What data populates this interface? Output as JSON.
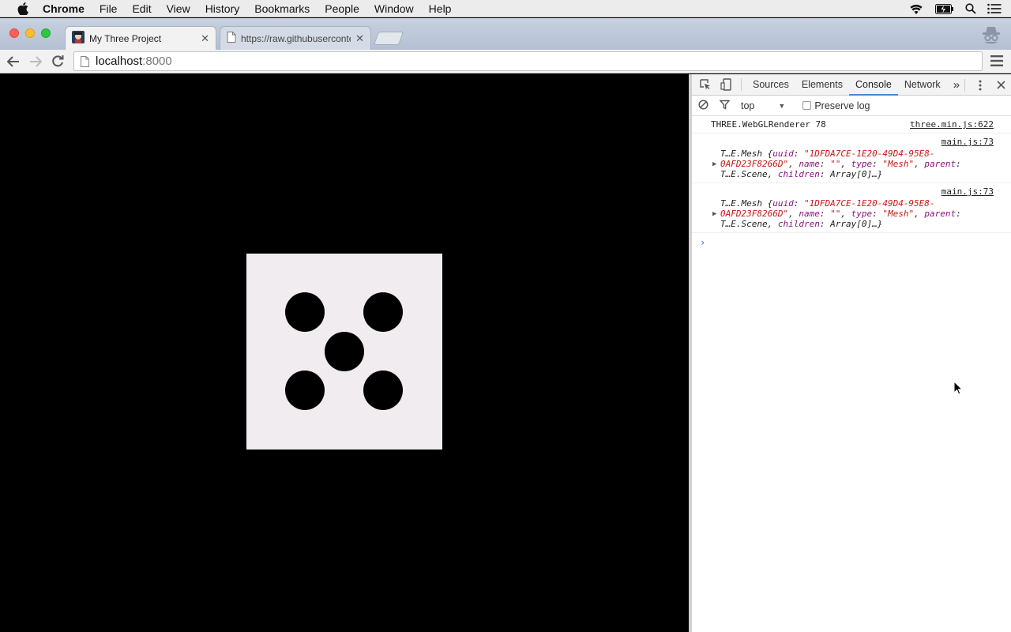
{
  "menubar": {
    "app": "Chrome",
    "items": [
      "File",
      "Edit",
      "View",
      "History",
      "Bookmarks",
      "People",
      "Window",
      "Help"
    ]
  },
  "tabs": [
    {
      "title": "My Three Project",
      "active": true
    },
    {
      "title": "https://raw.githubuserconte",
      "active": false
    }
  ],
  "toolbar": {
    "host": "localhost",
    "port": ":8000"
  },
  "devtools": {
    "panels": [
      "Sources",
      "Elements",
      "Console",
      "Network"
    ],
    "active_panel": "Console",
    "more_label": "»",
    "context": "top",
    "preserve_log": "Preserve log"
  },
  "console": {
    "messages": [
      {
        "text": "THREE.WebGLRenderer 78",
        "source": "three.min.js:622"
      },
      {
        "source": "main.js:73",
        "type_prefix": "T…E.Mesh {",
        "uuid_key": "uuid",
        "uuid_val": "\"1DFDA7CE-1E20-49D4-95E8-",
        "uuid_val2": "0AFD23F8266D\"",
        "name_key": "name",
        "name_val": "\"\"",
        "type_key": "type",
        "type_val": "\"Mesh\"",
        "parent_key": "parent",
        "parent_val": "T…E.Scene",
        "children_key": "children",
        "children_val": "Array[0]…}"
      },
      {
        "source": "main.js:73",
        "type_prefix": "T…E.Mesh {",
        "uuid_key": "uuid",
        "uuid_val": "\"1DFDA7CE-1E20-49D4-95E8-",
        "uuid_val2": "0AFD23F8266D\"",
        "name_key": "name",
        "name_val": "\"\"",
        "type_key": "type",
        "type_val": "\"Mesh\"",
        "parent_key": "parent",
        "parent_val": "T…E.Scene",
        "children_key": "children",
        "children_val": "Array[0]…}"
      }
    ],
    "prompt": "›"
  },
  "colors": {
    "die_face": "#f0ecf0",
    "pip": "#000000",
    "active_tab_underline": "#4a85d6",
    "console_key": "#881280",
    "console_string": "#c41a16"
  },
  "icons": [
    "apple-icon",
    "wifi-icon",
    "battery-icon",
    "spotlight-icon",
    "notification-list-icon",
    "incognito-icon",
    "back-icon",
    "forward-icon",
    "reload-icon",
    "page-icon",
    "chrome-menu-icon",
    "inspect-icon",
    "device-mode-icon",
    "kebab-menu-icon",
    "close-devtools-icon",
    "clear-console-icon",
    "filter-icon",
    "expand-triangle-icon",
    "mouse-cursor-icon"
  ]
}
